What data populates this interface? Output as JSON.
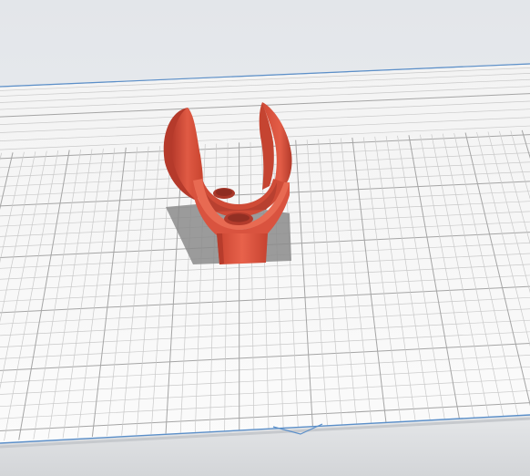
{
  "viewport": {
    "background": "#e5e8eb",
    "plate_color": "#f6f6f6",
    "grid_minor_color": "#c9c9c9",
    "grid_major_color": "#a5a5a5",
    "plate_edge_color": "#5b8fc9",
    "model_color": "#d9533f",
    "model_shadow_color": "#8a8a8a"
  }
}
